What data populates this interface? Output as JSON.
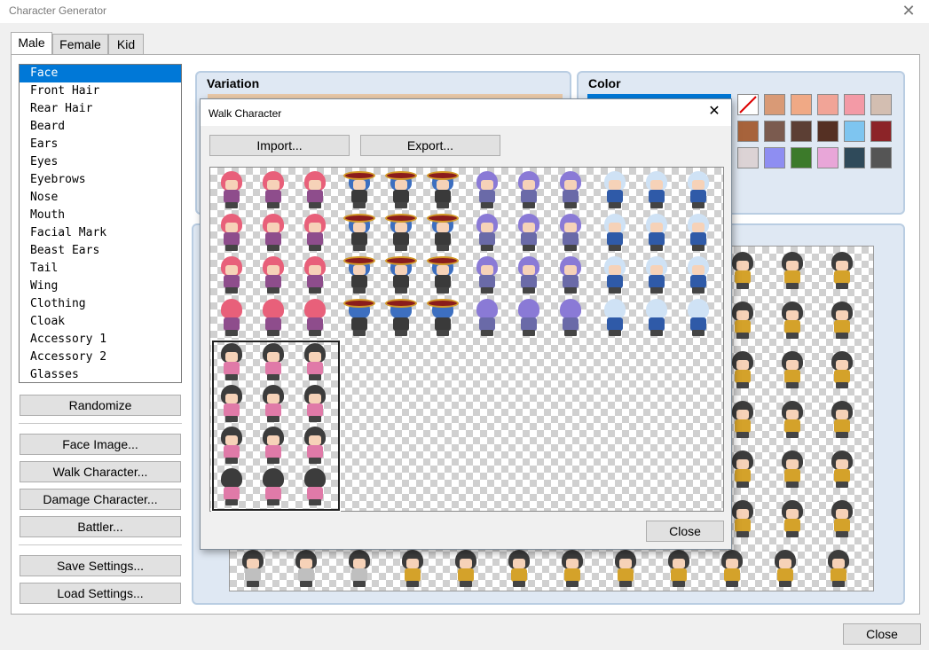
{
  "window": {
    "title": "Character Generator",
    "close_glyph": "✕"
  },
  "tabs": [
    {
      "label": "Male",
      "active": true
    },
    {
      "label": "Female",
      "active": false
    },
    {
      "label": "Kid",
      "active": false
    }
  ],
  "parts": [
    "Face",
    "Front Hair",
    "Rear Hair",
    "Beard",
    "Ears",
    "Eyes",
    "Eyebrows",
    "Nose",
    "Mouth",
    "Facial Mark",
    "Beast Ears",
    "Tail",
    "Wing",
    "Clothing",
    "Cloak",
    "Accessory 1",
    "Accessory 2",
    "Glasses"
  ],
  "selected_part": "Face",
  "buttons": {
    "randomize": "Randomize",
    "face_image": "Face Image...",
    "walk_character": "Walk Character...",
    "damage_character": "Damage Character...",
    "battler": "Battler...",
    "save_settings": "Save Settings...",
    "load_settings": "Load Settings...",
    "close": "Close"
  },
  "variation": {
    "label": "Variation"
  },
  "color": {
    "label": "Color",
    "swatches": [
      "none",
      "#d99a76",
      "#f0a985",
      "#f1a497",
      "#f39aa6",
      "#d3beb1",
      "#a7633b",
      "#7b5b4f",
      "#5c3f34",
      "#553023",
      "#7ec5f0",
      "#8c2428",
      "#dcd3d5",
      "#8e8ef2",
      "#3c7a2a",
      "#e8a6d8",
      "#2f4a5a",
      "#555555"
    ]
  },
  "walk_dialog": {
    "title": "Walk Character",
    "import_label": "Import...",
    "export_label": "Export...",
    "close_label": "Close",
    "close_glyph": "✕"
  }
}
